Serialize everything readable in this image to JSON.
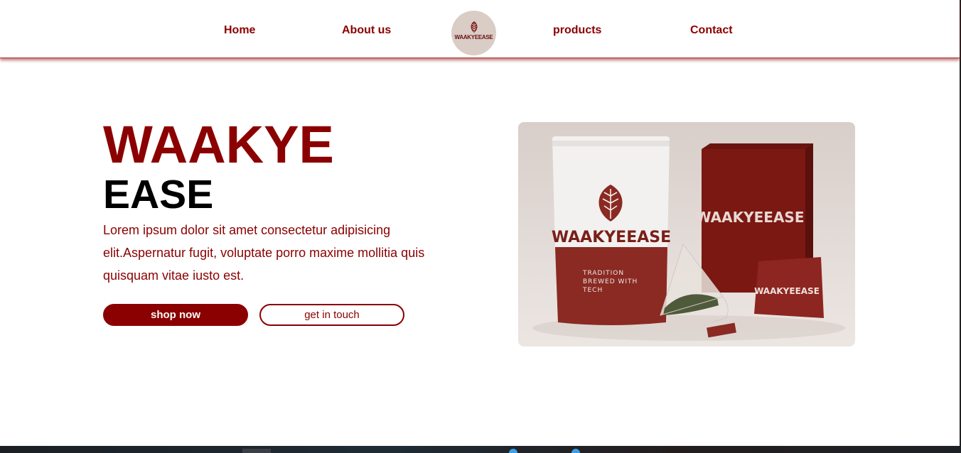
{
  "nav": {
    "home": "Home",
    "about": "About us",
    "products": "products",
    "contact": "Contact",
    "logo_text": "WAAKYEEASE"
  },
  "hero": {
    "title_line1": "WAAKYE",
    "title_line2": "EASE",
    "description": "Lorem ipsum dolor sit amet consectetur adipisicing elit.Aspernatur fugit, voluptate porro maxime mollitia quis quisquam vitae iusto est.",
    "shop_button": "shop now",
    "contact_button": "get in touch"
  },
  "product_image": {
    "pouch_brand": "WAAKYEEASE",
    "pouch_tagline_1": "TRADITION",
    "pouch_tagline_2": "BREWED WITH",
    "pouch_tagline_3": "TECH",
    "box_brand": "WAAKYEEASE",
    "sachet_brand": "WAAKYEEASE"
  },
  "colors": {
    "brand_red": "#8b0000",
    "logo_bg": "#d9cdc6",
    "text_dark": "#000000"
  }
}
